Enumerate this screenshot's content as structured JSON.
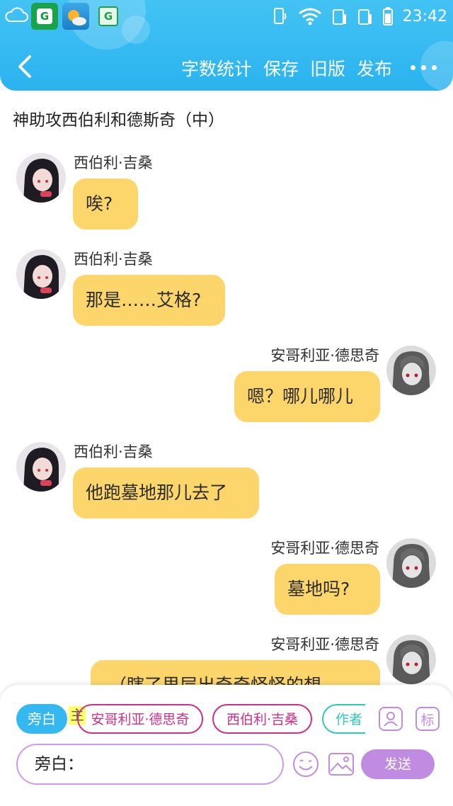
{
  "status_bar": {
    "time": "23:42"
  },
  "toolbar": {
    "word_count": "字数统计",
    "save": "保存",
    "old_version": "旧版",
    "publish": "发布"
  },
  "document": {
    "title": "神助攻西伯利和德斯奇（中）"
  },
  "messages": [
    {
      "sender": "西伯利·吉桑",
      "side": "left",
      "text": "唉?"
    },
    {
      "sender": "西伯利·吉桑",
      "side": "left",
      "text": "那是……艾格?"
    },
    {
      "sender": "安哥利亚·德思奇",
      "side": "right",
      "text": "嗯？哪儿哪儿"
    },
    {
      "sender": "西伯利·吉桑",
      "side": "left",
      "text": "他跑墓地那儿去了"
    },
    {
      "sender": "安哥利亚·德思奇",
      "side": "right",
      "text": "墓地吗?"
    },
    {
      "sender": "安哥利亚·德思奇",
      "side": "right",
      "text": "（瞎了里层出奇奇怪怪的想"
    }
  ],
  "composer": {
    "narration_chip": "旁白",
    "main_marker": "主",
    "characters": [
      "安哥利亚·德思奇",
      "西伯利·吉桑",
      "作者"
    ],
    "tag_button": "标",
    "input_value": "旁白：",
    "send_label": "发送"
  },
  "colors": {
    "header": "#2ab3ef",
    "bubble": "#fdd66b",
    "chip_active": "#35b8ef",
    "character_chip": "#cf2f87",
    "author_chip": "#2ccbb8",
    "send_button": "#c08ce2"
  },
  "icons": [
    "cloud-icon",
    "app-icon",
    "weather-icon",
    "wifi-icon",
    "signal-icon",
    "battery-icon",
    "back-icon",
    "more-icon",
    "character-icon",
    "emoji-icon",
    "image-icon"
  ]
}
